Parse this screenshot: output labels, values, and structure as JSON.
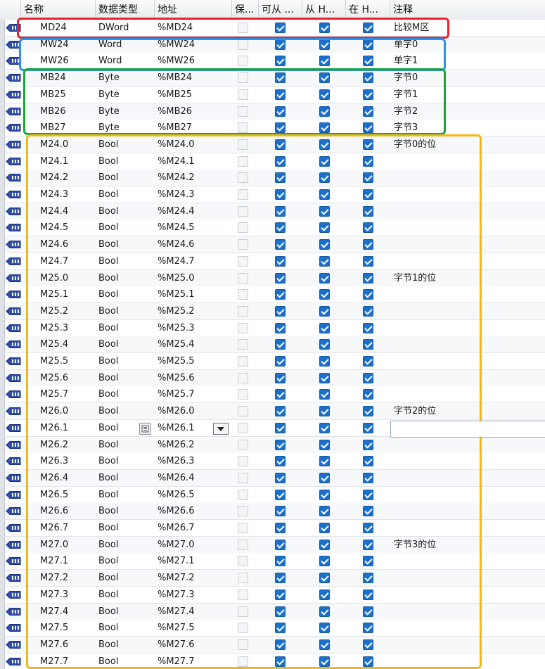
{
  "columns": {
    "name": "名称",
    "data_type": "数据类型",
    "address": "地址",
    "retain": "保...",
    "accessible": "可从 ...",
    "writable": "从 H...",
    "visible": "在 H...",
    "comment": "注释"
  },
  "rows": [
    {
      "name": "MD24",
      "type": "DWord",
      "address": "%MD24",
      "comment": "比较M区"
    },
    {
      "name": "MW24",
      "type": "Word",
      "address": "%MW24",
      "comment": "单字0"
    },
    {
      "name": "MW26",
      "type": "Word",
      "address": "%MW26",
      "comment": "单字1"
    },
    {
      "name": "MB24",
      "type": "Byte",
      "address": "%MB24",
      "comment": "字节0"
    },
    {
      "name": "MB25",
      "type": "Byte",
      "address": "%MB25",
      "comment": "字节1"
    },
    {
      "name": "MB26",
      "type": "Byte",
      "address": "%MB26",
      "comment": "字节2"
    },
    {
      "name": "MB27",
      "type": "Byte",
      "address": "%MB27",
      "comment": "字节3"
    },
    {
      "name": "M24.0",
      "type": "Bool",
      "address": "%M24.0",
      "comment": "字节0的位"
    },
    {
      "name": "M24.1",
      "type": "Bool",
      "address": "%M24.1",
      "comment": ""
    },
    {
      "name": "M24.2",
      "type": "Bool",
      "address": "%M24.2",
      "comment": ""
    },
    {
      "name": "M24.3",
      "type": "Bool",
      "address": "%M24.3",
      "comment": ""
    },
    {
      "name": "M24.4",
      "type": "Bool",
      "address": "%M24.4",
      "comment": ""
    },
    {
      "name": "M24.5",
      "type": "Bool",
      "address": "%M24.5",
      "comment": ""
    },
    {
      "name": "M24.6",
      "type": "Bool",
      "address": "%M24.6",
      "comment": ""
    },
    {
      "name": "M24.7",
      "type": "Bool",
      "address": "%M24.7",
      "comment": ""
    },
    {
      "name": "M25.0",
      "type": "Bool",
      "address": "%M25.0",
      "comment": "字节1的位"
    },
    {
      "name": "M25.1",
      "type": "Bool",
      "address": "%M25.1",
      "comment": ""
    },
    {
      "name": "M25.2",
      "type": "Bool",
      "address": "%M25.2",
      "comment": ""
    },
    {
      "name": "M25.3",
      "type": "Bool",
      "address": "%M25.3",
      "comment": ""
    },
    {
      "name": "M25.4",
      "type": "Bool",
      "address": "%M25.4",
      "comment": ""
    },
    {
      "name": "M25.5",
      "type": "Bool",
      "address": "%M25.5",
      "comment": ""
    },
    {
      "name": "M25.6",
      "type": "Bool",
      "address": "%M25.6",
      "comment": ""
    },
    {
      "name": "M25.7",
      "type": "Bool",
      "address": "%M25.7",
      "comment": ""
    },
    {
      "name": "M26.0",
      "type": "Bool",
      "address": "%M26.0",
      "comment": "字节2的位"
    },
    {
      "name": "M26.1",
      "type": "Bool",
      "address": "%M26.1",
      "comment": ""
    },
    {
      "name": "M26.2",
      "type": "Bool",
      "address": "%M26.2",
      "comment": ""
    },
    {
      "name": "M26.3",
      "type": "Bool",
      "address": "%M26.3",
      "comment": ""
    },
    {
      "name": "M26.4",
      "type": "Bool",
      "address": "%M26.4",
      "comment": ""
    },
    {
      "name": "M26.5",
      "type": "Bool",
      "address": "%M26.5",
      "comment": ""
    },
    {
      "name": "M26.6",
      "type": "Bool",
      "address": "%M26.6",
      "comment": ""
    },
    {
      "name": "M26.7",
      "type": "Bool",
      "address": "%M26.7",
      "comment": ""
    },
    {
      "name": "M27.0",
      "type": "Bool",
      "address": "%M27.0",
      "comment": "字节3的位"
    },
    {
      "name": "M27.1",
      "type": "Bool",
      "address": "%M27.1",
      "comment": ""
    },
    {
      "name": "M27.2",
      "type": "Bool",
      "address": "%M27.2",
      "comment": ""
    },
    {
      "name": "M27.3",
      "type": "Bool",
      "address": "%M27.3",
      "comment": ""
    },
    {
      "name": "M27.4",
      "type": "Bool",
      "address": "%M27.4",
      "comment": ""
    },
    {
      "name": "M27.5",
      "type": "Bool",
      "address": "%M27.5",
      "comment": ""
    },
    {
      "name": "M27.6",
      "type": "Bool",
      "address": "%M27.6",
      "comment": ""
    },
    {
      "name": "M27.7",
      "type": "Bool",
      "address": "%M27.7",
      "comment": ""
    }
  ],
  "flags": {
    "retain": false,
    "accessible": true,
    "writable": true,
    "visible": true
  },
  "icons": {
    "tag": "plc-tag-icon",
    "picker": "datatype-picker-icon",
    "dropdown": "chevron-down-icon"
  },
  "highlight_colors": {
    "dword": "#e8222a",
    "word": "#2f8fe8",
    "byte": "#1fa33a",
    "bool": "#f5b716"
  }
}
